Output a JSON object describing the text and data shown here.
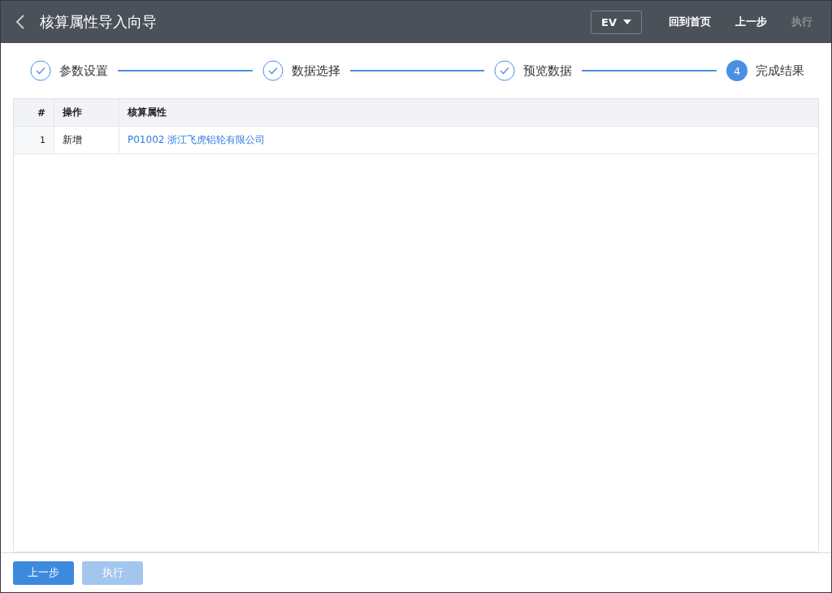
{
  "header": {
    "title": "核算属性导入向导",
    "dropdown": "EV",
    "actions": [
      {
        "label": "回到首页",
        "disabled": false
      },
      {
        "label": "上一步",
        "disabled": false
      },
      {
        "label": "执行",
        "disabled": true
      }
    ]
  },
  "steps": [
    {
      "label": "参数设置",
      "done": true
    },
    {
      "label": "数据选择",
      "done": true
    },
    {
      "label": "预览数据",
      "done": true
    },
    {
      "label": "完成结果",
      "done": false,
      "number": "4"
    }
  ],
  "table": {
    "columns": [
      "#",
      "操作",
      "核算属性"
    ],
    "rows": [
      {
        "index": "1",
        "operation": "新增",
        "attribute": "P01002 浙江飞虎铝轮有限公司"
      }
    ]
  },
  "footer": {
    "buttons": [
      {
        "label": "上一步",
        "disabled": false
      },
      {
        "label": "执行",
        "disabled": true
      }
    ]
  }
}
